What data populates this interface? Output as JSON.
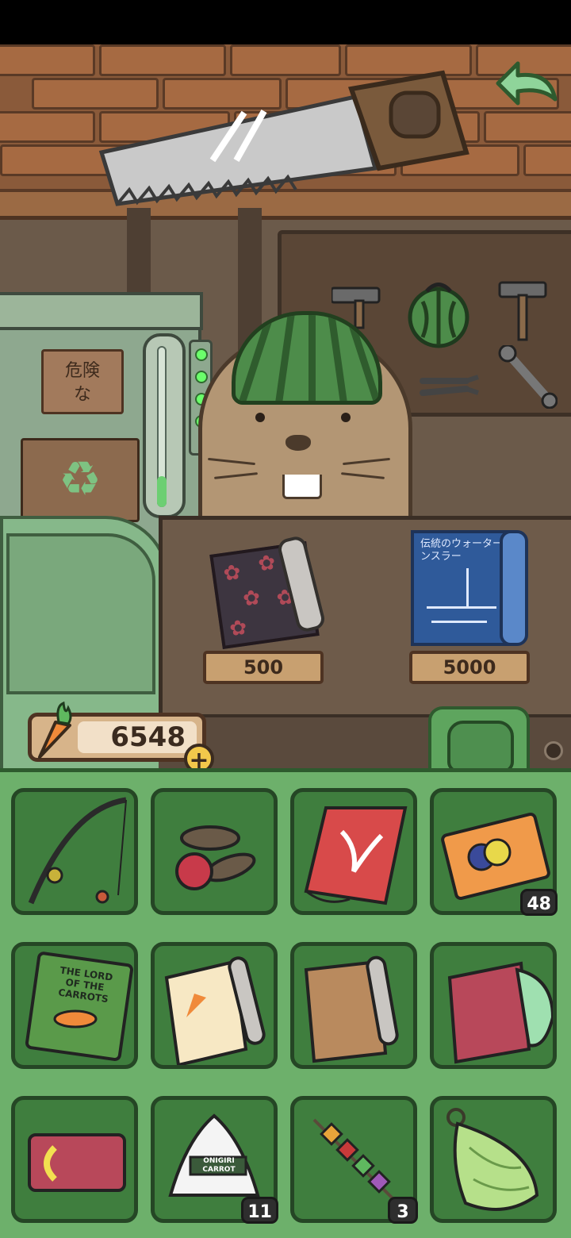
{
  "scene": {
    "sign_line1": "危険",
    "sign_line2": "な",
    "recycle_glyph": "♻",
    "gauge_level": 0.2
  },
  "shop": {
    "items": [
      {
        "name": "sakura wrapping paper",
        "price": "500"
      },
      {
        "name": "blueprint scroll",
        "price": "5000",
        "text": "伝統のウォーターンスラー"
      }
    ]
  },
  "wallet": {
    "carrots": "6548",
    "plus": "+"
  },
  "inventory": {
    "slots": [
      {
        "item": "fishing rod",
        "count": ""
      },
      {
        "item": "wooden toys",
        "count": ""
      },
      {
        "item": "red kite",
        "count": ""
      },
      {
        "item": "collection ticket",
        "count": "48"
      },
      {
        "item": "lord of the carrots book",
        "count": "",
        "label": "THE LORD OF THE CARROTS"
      },
      {
        "item": "carrot wrapping paper",
        "count": ""
      },
      {
        "item": "brown wrapping paper",
        "count": ""
      },
      {
        "item": "red wrapping paper",
        "count": ""
      },
      {
        "item": "red card",
        "count": ""
      },
      {
        "item": "onigiri",
        "count": "11",
        "label": "ONIGIRI CARROT"
      },
      {
        "item": "skewer",
        "count": "3"
      },
      {
        "item": "green bundle",
        "count": ""
      }
    ]
  },
  "colors": {
    "inventory_bg": "#6db06b",
    "slot_bg": "#3f7e3e",
    "back_arrow": "#8fd49a"
  }
}
